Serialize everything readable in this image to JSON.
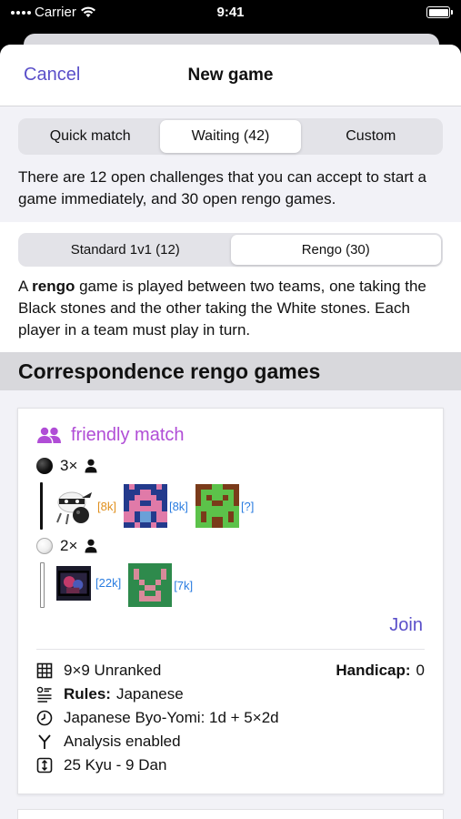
{
  "status_bar": {
    "carrier": "Carrier",
    "time": "9:41"
  },
  "nav": {
    "cancel": "Cancel",
    "title": "New game"
  },
  "mode_tabs": [
    {
      "label": "Quick match",
      "active": false
    },
    {
      "label": "Waiting (42)",
      "active": true
    },
    {
      "label": "Custom",
      "active": false
    }
  ],
  "summary": "There are 12 open challenges that you can accept to start a game immediately, and 30 open rengo games.",
  "type_tabs": [
    {
      "label": "Standard 1v1 (12)",
      "active": false
    },
    {
      "label": "Rengo (30)",
      "active": true
    }
  ],
  "rengo_desc": {
    "prefix": "A ",
    "bold": "rengo",
    "rest": " game is played between two teams, one taking the Black stones and the other taking the White stones. Each player in a team must play in turn."
  },
  "section_title": "Correspondence rengo games",
  "card": {
    "title": "friendly match",
    "title_icon": "people-icon",
    "black_team": {
      "count": "3×",
      "members": [
        {
          "rank": "[8k]",
          "rank_color": "#e0901e",
          "avatar": "ninja-avatar"
        },
        {
          "rank": "[8k]",
          "rank_color": "#2b7de0",
          "avatar": "blue-pink-pixel-avatar"
        },
        {
          "rank": "[?]",
          "rank_color": "#2b7de0",
          "avatar": "green-brown-pixel-avatar"
        }
      ]
    },
    "white_team": {
      "count": "2×",
      "members": [
        {
          "rank": "[22k]",
          "rank_color": "#2b7de0",
          "avatar": "dark-photo-avatar"
        },
        {
          "rank": "[7k]",
          "rank_color": "#2b7de0",
          "avatar": "green-pink-pixel-avatar"
        }
      ]
    },
    "join": "Join",
    "details": {
      "board": "9×9 Unranked",
      "handicap_label": "Handicap:",
      "handicap_value": "0",
      "rules_label": "Rules:",
      "rules_value": "Japanese",
      "time": "Japanese Byo-Yomi: 1d + 5×2d",
      "analysis": "Analysis enabled",
      "rank_range": "25 Kyu - 9 Dan"
    }
  },
  "colors": {
    "accent": "#5a4fc9",
    "title_purple": "#b04dd6"
  }
}
